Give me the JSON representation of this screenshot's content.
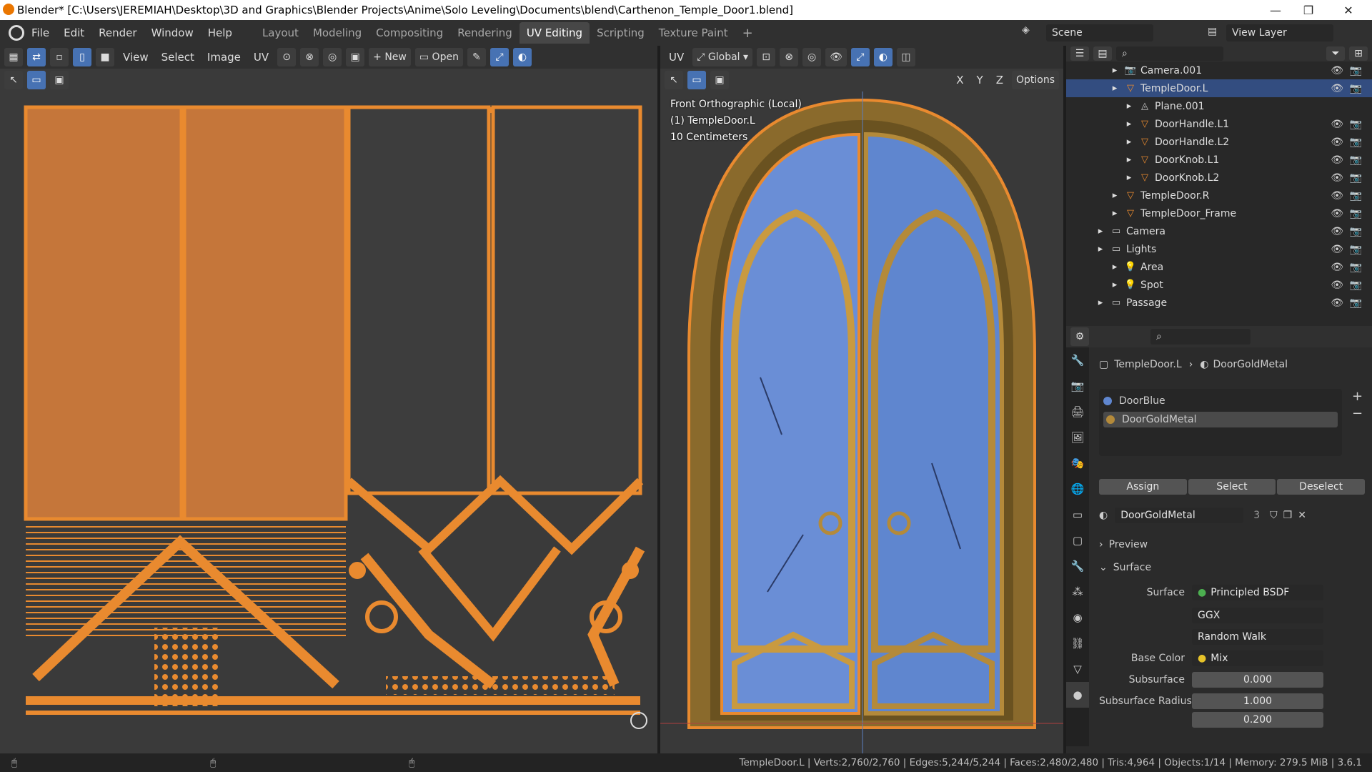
{
  "titlebar": {
    "title": "Blender* [C:\\Users\\JEREMIAH\\Desktop\\3D and Graphics\\Blender Projects\\Anime\\Solo Leveling\\Documents\\blend\\Carthenon_Temple_Door1.blend]",
    "minimize": "—",
    "maximize": "❐",
    "close": "✕"
  },
  "menu": [
    "File",
    "Edit",
    "Render",
    "Window",
    "Help"
  ],
  "workspaces": [
    "Layout",
    "Modeling",
    "Compositing",
    "Rendering",
    "UV Editing",
    "Scripting",
    "Texture Paint"
  ],
  "workspace_add": "+",
  "scene": {
    "label": "Scene",
    "view_layer": "View Layer"
  },
  "uv_editor": {
    "menus": [
      "View",
      "Select",
      "Image",
      "UV"
    ],
    "new_label": "New",
    "open_label": "Open"
  },
  "viewport": {
    "mode_label": "UV",
    "orientation": "Global",
    "options": "Options",
    "axes": [
      "X",
      "Y",
      "Z"
    ],
    "overlay_lines": [
      "Front Orthographic (Local)",
      "(1) TempleDoor.L",
      "10 Centimeters"
    ]
  },
  "outliner": {
    "rows": [
      {
        "label": "Camera.001",
        "indent": 3,
        "kind": "camera",
        "visible": true,
        "selected": false
      },
      {
        "label": "TempleDoor.L",
        "indent": 3,
        "kind": "mesh",
        "visible": true,
        "selected": true
      },
      {
        "label": "Plane.001",
        "indent": 4,
        "kind": "mesh-data",
        "visible": false,
        "selected": false
      },
      {
        "label": "DoorHandle.L1",
        "indent": 4,
        "kind": "mesh",
        "visible": true,
        "selected": false
      },
      {
        "label": "DoorHandle.L2",
        "indent": 4,
        "kind": "mesh",
        "visible": true,
        "selected": false
      },
      {
        "label": "DoorKnob.L1",
        "indent": 4,
        "kind": "mesh",
        "visible": true,
        "selected": false
      },
      {
        "label": "DoorKnob.L2",
        "indent": 4,
        "kind": "mesh",
        "visible": true,
        "selected": false
      },
      {
        "label": "TempleDoor.R",
        "indent": 3,
        "kind": "mesh",
        "visible": true,
        "selected": false
      },
      {
        "label": "TempleDoor_Frame",
        "indent": 3,
        "kind": "mesh",
        "visible": true,
        "selected": false
      },
      {
        "label": "Camera",
        "indent": 2,
        "kind": "collection",
        "visible": true,
        "selected": false
      },
      {
        "label": "Lights",
        "indent": 2,
        "kind": "collection",
        "visible": true,
        "selected": false
      },
      {
        "label": "Area",
        "indent": 3,
        "kind": "light",
        "visible": true,
        "selected": false
      },
      {
        "label": "Spot",
        "indent": 3,
        "kind": "light",
        "visible": true,
        "selected": false
      },
      {
        "label": "Passage",
        "indent": 2,
        "kind": "collection",
        "visible": true,
        "selected": false
      }
    ]
  },
  "properties": {
    "breadcrumb_object": "TempleDoor.L",
    "breadcrumb_material": "DoorGoldMetal",
    "slots": [
      "DoorBlue",
      "DoorGoldMetal"
    ],
    "assign": "Assign",
    "select": "Select",
    "deselect": "Deselect",
    "material_name": "DoorGoldMetal",
    "users": "3",
    "preview": "Preview",
    "surface_header": "Surface",
    "surface_label": "Surface",
    "surface_value": "Principled BSDF",
    "distribution": "GGX",
    "subsurface_method": "Random Walk",
    "base_color_label": "Base Color",
    "base_color_value": "Mix",
    "subsurface_label": "Subsurface",
    "subsurface_value": "0.000",
    "ssr_label": "Subsurface Radius",
    "ssr_values": [
      "1.000",
      "0.200"
    ]
  },
  "status": {
    "text": "TempleDoor.L | Verts:2,760/2,760 | Edges:5,244/5,244 | Faces:2,480/2,480 | Tris:4,964 | Objects:1/14 | Memory: 279.5 MiB | 3.6.1"
  },
  "colors": {
    "accent": "#4772b3",
    "uv_orange": "#e98a2f",
    "door_blue": "#6a8ed6",
    "gold": "#b48a3a"
  }
}
